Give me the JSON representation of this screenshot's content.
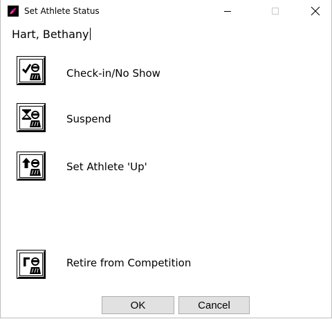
{
  "window": {
    "title": "Set Athlete Status",
    "controls": {
      "minimize": "–",
      "maximize": "□",
      "close": "✕"
    }
  },
  "athlete": {
    "name": "Hart, Bethany"
  },
  "actions": [
    {
      "label": "Check-in/No Show",
      "icon": "checkmark-athlete-icon"
    },
    {
      "label": "Suspend",
      "icon": "hourglass-athlete-icon"
    },
    {
      "label": "Set Athlete 'Up'",
      "icon": "up-arrow-athlete-icon"
    },
    {
      "label": "Retire from Competition",
      "icon": "retire-athlete-icon"
    }
  ],
  "buttons": {
    "ok": "OK",
    "cancel": "Cancel"
  }
}
